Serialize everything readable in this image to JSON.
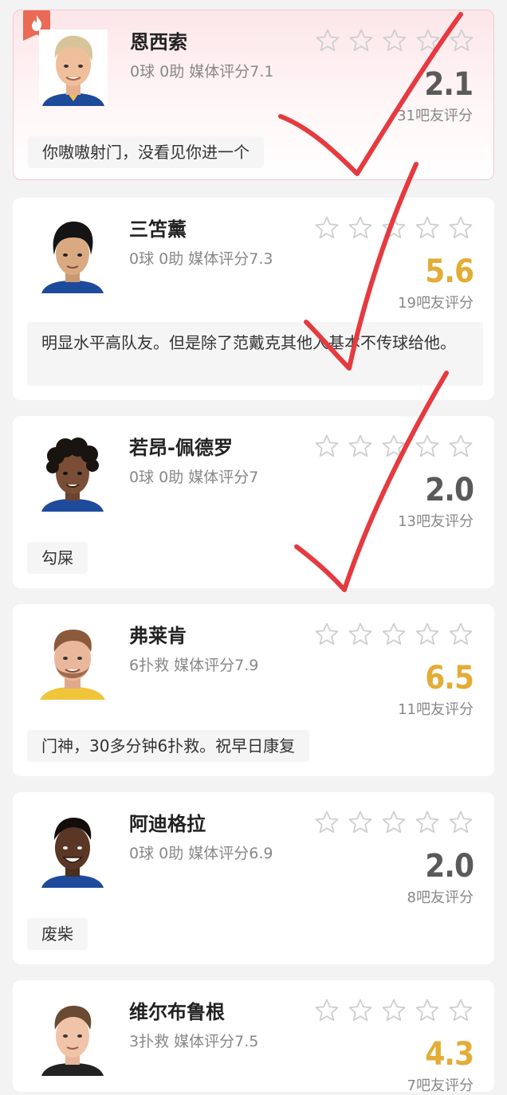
{
  "players": [
    {
      "name": "恩西索",
      "stats": "0球 0助   媒体评分7.1",
      "score": "2.1",
      "score_color": "#5a5a5a",
      "raters": "31吧友评分",
      "comment": "你嗷嗷射门，没看见你进一个",
      "hot": true
    },
    {
      "name": "三笘薰",
      "stats": "0球 0助   媒体评分7.3",
      "score": "5.6",
      "score_color": "#e4ac36",
      "raters": "19吧友评分",
      "comment": "明显水平高队友。但是除了范戴克其他人基本不传球给他。"
    },
    {
      "name": "若昂-佩德罗",
      "stats": "0球 0助   媒体评分7",
      "score": "2.0",
      "score_color": "#5a5a5a",
      "raters": "13吧友评分",
      "comment": "勾屎"
    },
    {
      "name": "弗莱肯",
      "stats": "6扑救   媒体评分7.9",
      "score": "6.5",
      "score_color": "#e4ac36",
      "raters": "11吧友评分",
      "comment": "门神，30多分钟6扑救。祝早日康复"
    },
    {
      "name": "阿迪格拉",
      "stats": "0球 0助   媒体评分6.9",
      "score": "2.0",
      "score_color": "#5a5a5a",
      "raters": "8吧友评分",
      "comment": "废柴"
    },
    {
      "name": "维尔布鲁根",
      "stats": "3扑救   媒体评分7.5",
      "score": "4.3",
      "score_color": "#e4ac36",
      "raters": "7吧友评分",
      "comment": ""
    }
  ],
  "icons": {
    "star": "star-outline-icon",
    "hot": "flame-icon"
  }
}
